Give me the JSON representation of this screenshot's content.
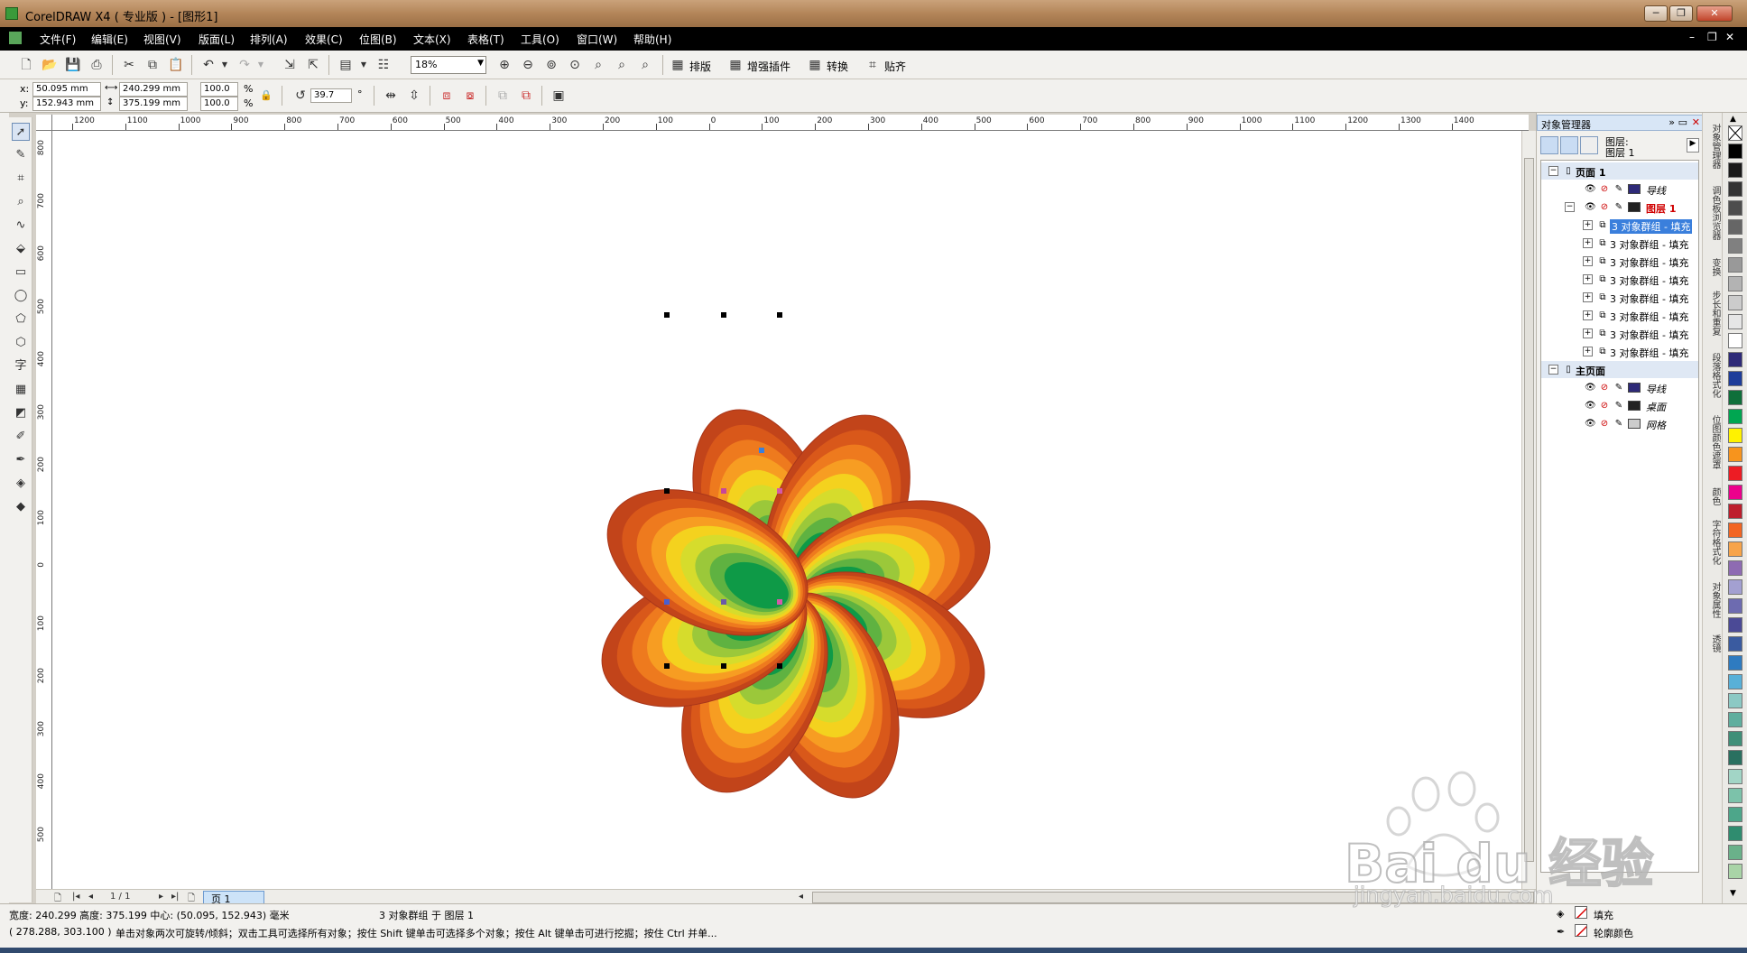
{
  "window": {
    "title": "CorelDRAW X4 ( 专业版 ) - [图形1]",
    "minimize": "─",
    "restore": "❐",
    "close": "✕"
  },
  "menu": [
    "文件(F)",
    "编辑(E)",
    "视图(V)",
    "版面(L)",
    "排列(A)",
    "效果(C)",
    "位图(B)",
    "文本(X)",
    "表格(T)",
    "工具(O)",
    "窗口(W)",
    "帮助(H)"
  ],
  "toolbar": {
    "zoom": "18%",
    "btn_layout": "排版",
    "btn_plugins": "增强插件",
    "btn_convert": "转换",
    "btn_snap": "贴齐"
  },
  "props": {
    "x_label": "x:",
    "x": "50.095 mm",
    "y_label": "y:",
    "y": "152.943 mm",
    "width": "240.299 mm",
    "height": "375.199 mm",
    "scale_w": "100.0",
    "scale_h": "100.0",
    "pct": "%",
    "angle": "39.7",
    "deg": "°"
  },
  "rulers": {
    "h": [
      "1200",
      "1100",
      "1000",
      "900",
      "800",
      "700",
      "600",
      "500",
      "400",
      "300",
      "200",
      "100",
      "0",
      "100",
      "200",
      "300",
      "400",
      "500",
      "600",
      "700",
      "800",
      "900",
      "1000",
      "1100",
      "1200",
      "1300",
      "1400"
    ],
    "v": [
      "800",
      "700",
      "600",
      "500",
      "400",
      "300",
      "200",
      "100",
      "0",
      "100",
      "200",
      "300",
      "400",
      "500"
    ]
  },
  "pages": {
    "counter": "1 / 1",
    "tab": "页 1"
  },
  "docker": {
    "title": "对象管理器",
    "layer_label": "图层:",
    "layer_value": "图层 1",
    "page1": "页面 1",
    "guides": "导线",
    "layer1": "图层 1",
    "groups": [
      "3 对象群组 - 填充",
      "3 对象群组 - 填充",
      "3 对象群组 - 填充",
      "3 对象群组 - 填充",
      "3 对象群组 - 填充",
      "3 对象群组 - 填充",
      "3 对象群组 - 填充",
      "3 对象群组 - 填充"
    ],
    "master": "主页面",
    "master_guides": "导线",
    "desktop": "桌面",
    "grid": "网格"
  },
  "side_tabs": [
    "对象管理器",
    "调色板浏览器",
    "变换",
    "步长和重复",
    "段落格式化",
    "位图颜色遮罩",
    "颜色",
    "字符格式化",
    "对象属性",
    "透镜"
  ],
  "palette": [
    "#000000",
    "#1a1a1a",
    "#333333",
    "#4d4d4d",
    "#666666",
    "#808080",
    "#999999",
    "#b3b3b3",
    "#cccccc",
    "#e6e6e6",
    "#ffffff",
    "#2e2a78",
    "#1e3d9a",
    "#0f6f3a",
    "#00a651",
    "#fff200",
    "#f7941d",
    "#ed1c24",
    "#ec008c",
    "#be1e2d",
    "#f26522",
    "#f7a44a",
    "#8e6bb2",
    "#a3a0d1",
    "#6d6bb0",
    "#4b4a96",
    "#3a5ba0",
    "#2e7bc0",
    "#58b0d8",
    "#8cc9c4",
    "#5fae9e",
    "#3f8f78",
    "#2a7060",
    "#a2d5c6",
    "#7cc2aa",
    "#4da68a",
    "#2f8c6f",
    "#6ab18a",
    "#a9d4a7"
  ],
  "status": {
    "size": "宽度: 240.299 高度: 375.199 中心: (50.095, 152.943) 毫米",
    "selection": "3 对象群组 于 图层 1",
    "coords": "( 278.288, 303.100 )",
    "hint": "单击对象两次可旋转/倾斜；双击工具可选择所有对象；按住 Shift 键单击可选择多个对象；按住 Alt 键单击可进行挖掘；按住 Ctrl 并单...",
    "fill": "填充",
    "outline": "轮廓颜色"
  },
  "watermark": {
    "brand": "Bai du 经验",
    "url": "jingyan.baidu.com"
  },
  "colors": {
    "petal_outer": "#c2441a",
    "petal_mid": "#f4d21e",
    "petal_core": "#0e9a47",
    "selection_accent": "#3a7fdc"
  }
}
